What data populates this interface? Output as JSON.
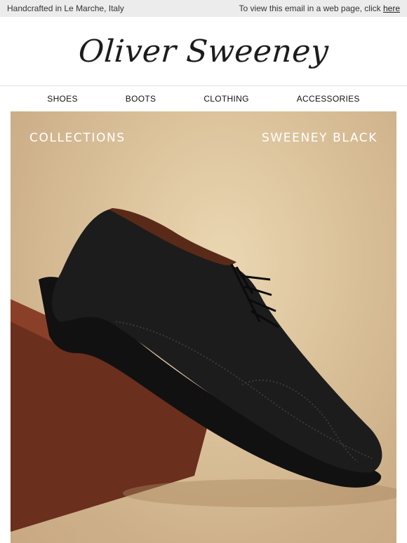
{
  "topbar": {
    "left_text": "Handcrafted in Le Marche, Italy",
    "right_text": "To view this email in a web page, click ",
    "link_text": "here"
  },
  "brand": {
    "name": "Oliver Sweeney"
  },
  "nav": {
    "items": [
      {
        "label": "SHOES"
      },
      {
        "label": "BOOTS"
      },
      {
        "label": "CLOTHING"
      },
      {
        "label": "ACCESSORIES"
      }
    ]
  },
  "hero": {
    "left_label": "COLLECTIONS",
    "right_label": "SWEENEY BLACK",
    "image": "black-brogue-shoe-on-wooden-block",
    "colors": {
      "background": "#d8bf98",
      "wood": "#6b2f1e",
      "shoe": "#1a1a1a"
    }
  }
}
